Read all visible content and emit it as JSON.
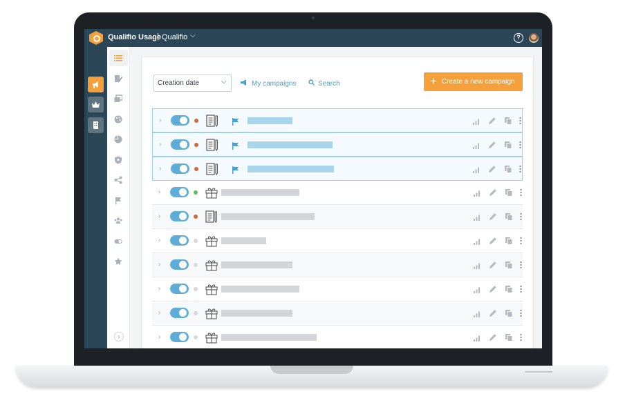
{
  "topbar": {
    "title": "Qualifio Usage",
    "separator": "|",
    "organization": "Qualifio",
    "org_chevron": "⌵",
    "help_glyph": "?"
  },
  "toolbar": {
    "sort_value": "Creation date",
    "sort_chevron": "⌵",
    "my_campaigns_label": "My campaigns",
    "search_label": "Search",
    "create_label": "Create a new campaign",
    "create_glyph": "+"
  },
  "sidebar": {
    "collapse_glyph": "›",
    "icons": [
      "list-icon",
      "edit-icon",
      "gallery-icon",
      "palette-icon",
      "pie-chart-icon",
      "shield-icon",
      "share-icon",
      "flag-icon",
      "users-icon",
      "toggle-icon",
      "star-icon"
    ]
  },
  "rail": {
    "items": [
      "campaigns-icon",
      "crown-icon",
      "building-icon"
    ]
  },
  "colors": {
    "accent": "#f5a03a",
    "nav": "#2b4656",
    "link": "#4a9fcf",
    "toggle_on": "#5dadd8",
    "selected_border": "#9fd0ea",
    "dot_orange": "#d4683a",
    "dot_green": "#5cc25a",
    "dot_grey": "#d5d8dc",
    "name_selected": "#a8d4ec",
    "name_default": "#d3d5d8"
  },
  "rows": [
    {
      "selected": true,
      "type": "form-icon",
      "status": "orange",
      "flagged": true,
      "name_fraction": 0.26
    },
    {
      "selected": true,
      "type": "form-icon",
      "status": "orange",
      "flagged": true,
      "name_fraction": 0.49
    },
    {
      "selected": true,
      "type": "form-icon",
      "status": "orange",
      "flagged": true,
      "name_fraction": 0.5
    },
    {
      "selected": false,
      "type": "gift-icon",
      "status": "green",
      "flagged": false,
      "name_fraction": 0.45
    },
    {
      "selected": false,
      "type": "form-icon",
      "status": "orange",
      "flagged": false,
      "name_fraction": 0.54
    },
    {
      "selected": false,
      "type": "gift-icon",
      "status": "grey",
      "flagged": false,
      "name_fraction": 0.26
    },
    {
      "selected": false,
      "type": "gift-icon",
      "status": "grey",
      "flagged": false,
      "name_fraction": 0.41
    },
    {
      "selected": false,
      "type": "gift-icon",
      "status": "grey",
      "flagged": false,
      "name_fraction": 0.45
    },
    {
      "selected": false,
      "type": "gift-icon",
      "status": "grey",
      "flagged": false,
      "name_fraction": 0.41
    },
    {
      "selected": false,
      "type": "gift-icon",
      "status": "grey",
      "flagged": false,
      "name_fraction": 0.55
    }
  ],
  "row_actions": [
    "stats-icon",
    "edit-icon",
    "duplicate-icon",
    "more-icon"
  ]
}
